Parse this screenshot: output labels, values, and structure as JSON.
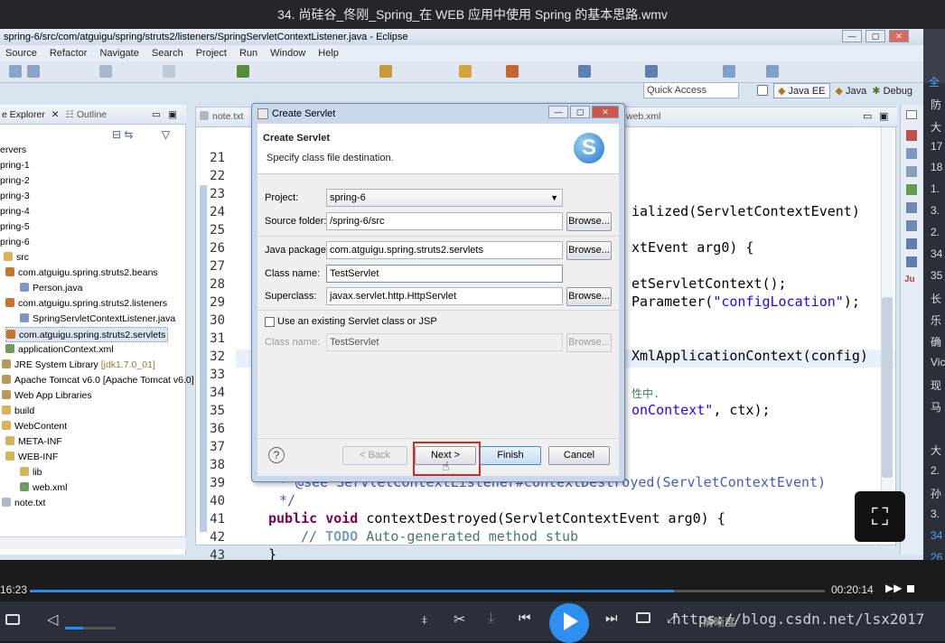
{
  "window_title": "34. 尚硅谷_佟刚_Spring_在 WEB 应用中使用 Spring 的基本思路.wmv",
  "eclipse": {
    "title": "spring-6/src/com/atguigu/spring/struts2/listeners/SpringServletContextListener.java - Eclipse",
    "menu": [
      "Source",
      "Refactor",
      "Navigate",
      "Search",
      "Project",
      "Run",
      "Window",
      "Help"
    ],
    "quick_access": "Quick Access",
    "perspectives": [
      "Java EE",
      "Java",
      "Debug"
    ],
    "explorer_tab": "e Explorer",
    "outline_tab": "Outline",
    "tree": [
      "ervers",
      "pring-1",
      "pring-2",
      "pring-3",
      "pring-4",
      "pring-5",
      "pring-6",
      "src",
      "com.atguigu.spring.struts2.beans",
      "Person.java",
      "com.atguigu.spring.struts2.listeners",
      "SpringServletContextListener.java",
      "com.atguigu.spring.struts2.servlets",
      "applicationContext.xml",
      "JRE System Library",
      "[jdk1.7.0_01]",
      "Apache Tomcat v6.0 [Apache Tomcat v6.0]",
      "Web App Libraries",
      "build",
      "WebContent",
      "META-INF",
      "WEB-INF",
      "lib",
      "web.xml",
      "note.txt"
    ],
    "editor_tabs": [
      "note.txt",
      "web.xml"
    ],
    "line_numbers": [
      "21",
      "22",
      "23",
      "24",
      "25",
      "26",
      "27",
      "28",
      "29",
      "30",
      "31",
      "32",
      "33",
      "34",
      "35",
      "36",
      "37",
      "38",
      "39",
      "40",
      "41",
      "42",
      "43"
    ],
    "code": {
      "l23": "ialized(ServletContextEvent)",
      "l26": "xtEvent arg0) {",
      "l28": "etServletContext();",
      "l29a": "Parameter(",
      "l29b": "\"configLocation\"",
      "l29c": ");",
      "l32": "XmlApplicationContext(config)",
      "l34": "性中.",
      "l35a": "onContext\"",
      "l35b": ", ctx);",
      "l39a": "* @see ",
      "l39b": "ServletContextListener#contextDestroyed(ServletContextEvent)",
      "l40": "*/",
      "l41a": "public void ",
      "l41b": "contextDestroyed(ServletContextEvent arg0) {",
      "l42a": "// ",
      "l42b": "TODO",
      "l42c": " Auto-generated method stub",
      "l43": "}"
    }
  },
  "dialog": {
    "title": "Create Servlet",
    "heading": "Create Servlet",
    "subheading": "Specify class file destination.",
    "project_label": "Project:",
    "project_value": "spring-6",
    "source_folder_label": "Source folder:",
    "source_folder_value": "/spring-6/src",
    "java_package_label": "Java package:",
    "java_package_value": "com.atguigu.spring.struts2.servlets",
    "class_name_label": "Class name:",
    "class_name_value": "TestServlet",
    "superclass_label": "Superclass:",
    "superclass_value": "javax.servlet.http.HttpServlet",
    "existing_checkbox_label": "Use an existing Servlet class or JSP",
    "existing_class_label": "Class name:",
    "existing_class_value": "TestServlet",
    "browse": "Browse...",
    "back": "< Back",
    "next": "Next >",
    "finish": "Finish",
    "cancel": "Cancel",
    "help": "?"
  },
  "player": {
    "elapsed": "16:23",
    "duration": "00:20:14",
    "progress": 0.81,
    "quality": "清晰度",
    "watermark": "https://blog.csdn.net/lsx2017"
  },
  "side_panel": [
    "全",
    "防",
    "大",
    "17",
    "18",
    "1.",
    "3.",
    "2.",
    "34",
    "35",
    "长",
    "乐",
    "确",
    "Vic",
    "现",
    "马",
    "大",
    "2.",
    "孙",
    "3.",
    "34",
    "26."
  ]
}
